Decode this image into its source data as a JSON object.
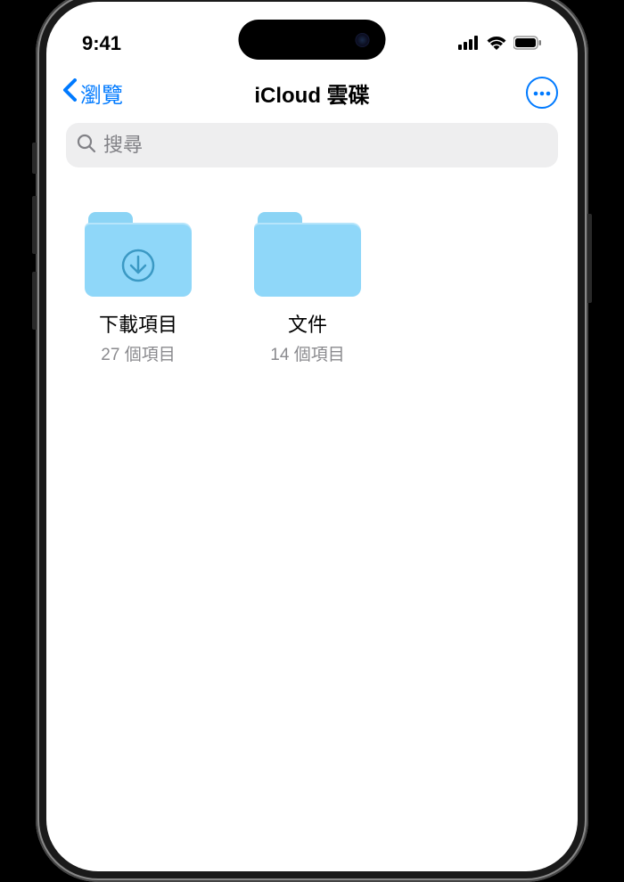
{
  "status": {
    "time": "9:41"
  },
  "nav": {
    "back_label": "瀏覽",
    "title": "iCloud 雲碟"
  },
  "search": {
    "placeholder": "搜尋"
  },
  "folders": [
    {
      "name": "下載項目",
      "count": "27 個項目",
      "has_download_badge": true
    },
    {
      "name": "文件",
      "count": "14 個項目",
      "has_download_badge": false
    }
  ]
}
